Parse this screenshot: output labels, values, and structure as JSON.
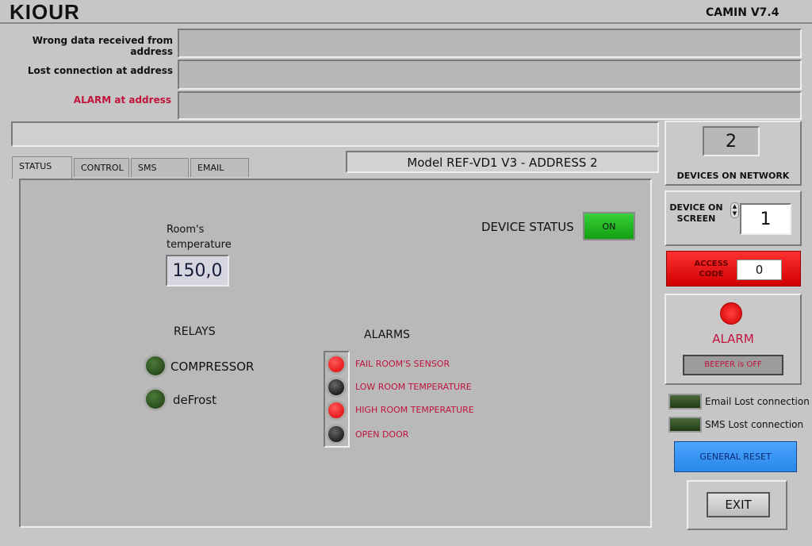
{
  "header": {
    "logo": "KIOUR",
    "version": "CAMIN V7.4"
  },
  "messages": [
    {
      "label": "Wrong data received from address",
      "value": ""
    },
    {
      "label": "Lost connection at address",
      "value": ""
    },
    {
      "label": "ALARM at address",
      "value": ""
    }
  ],
  "status_bar": "",
  "tabs": [
    {
      "label": "STATUS"
    },
    {
      "label": "CONTROL"
    },
    {
      "label": "SMS"
    },
    {
      "label": "EMAIL"
    }
  ],
  "model_info": "Model REF-VD1 V3 -  ADDRESS  2",
  "status": {
    "room_temp_label": "Room's temperature",
    "room_temp_value": "150,0",
    "device_status_label": "DEVICE STATUS",
    "device_status_value": "ON",
    "relays_title": "RELAYS",
    "relays": [
      {
        "label": "COMPRESSOR",
        "state": "off"
      },
      {
        "label": "deFrost",
        "state": "off"
      }
    ],
    "alarms_title": "ALARMS",
    "alarms": [
      {
        "label": "FAIL ROOM'S SENSOR",
        "state": "on"
      },
      {
        "label": "LOW ROOM TEMPERATURE",
        "state": "off"
      },
      {
        "label": "HIGH ROOM TEMPERATURE",
        "state": "on"
      },
      {
        "label": "OPEN DOOR",
        "state": "off"
      }
    ]
  },
  "side": {
    "devices_count": "2",
    "devices_label": "DEVICES ON NETWORK",
    "device_on_screen_label": "DEVICE ON SCREEN",
    "device_on_screen_value": "1",
    "access_label": "ACCESS CODE",
    "access_value": "0",
    "alarm_label": "ALARM",
    "beeper_label": "BEEPER is OFF",
    "email_lost": "Email Lost connection",
    "sms_lost": "SMS Lost connection",
    "reset_label": "GENERAL RESET",
    "exit_label": "EXIT"
  },
  "colors": {
    "alarm_red": "#c0143c",
    "on_green": "#22bb22",
    "reset_blue": "#3a96f0",
    "access_red": "#e00000"
  }
}
